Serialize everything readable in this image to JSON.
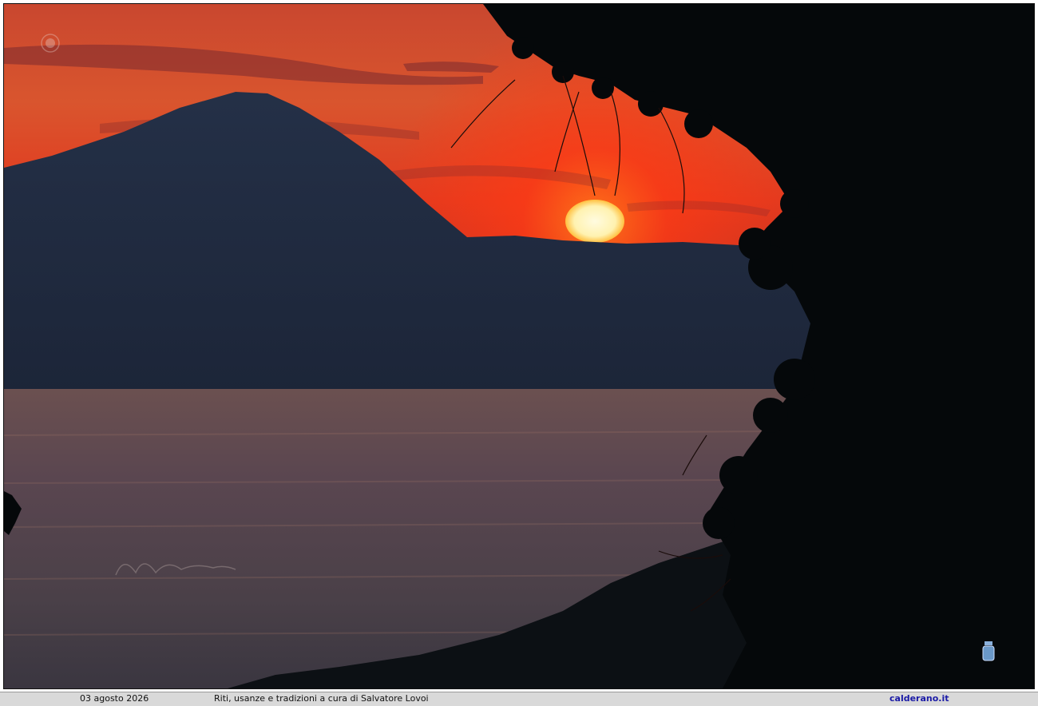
{
  "photo": {
    "subject": "sunset-over-sea-with-mountain-and-tree",
    "icons": {
      "top_left": "seal-watermark-icon",
      "bottom_right": "crest-icon",
      "center_left": "signature-watermark"
    },
    "colors": {
      "sky_top": "#d9552e",
      "sky_glow": "#ff3a14",
      "sun": "#fff2b0",
      "mountain": "#1c2538",
      "sea": "#4a4048",
      "foliage": "#05080a"
    }
  },
  "footer": {
    "date": "03 agosto 2026",
    "caption": "Riti, usanze e tradizioni a cura di Salvatore Lovoi",
    "site": "calderano.it"
  }
}
